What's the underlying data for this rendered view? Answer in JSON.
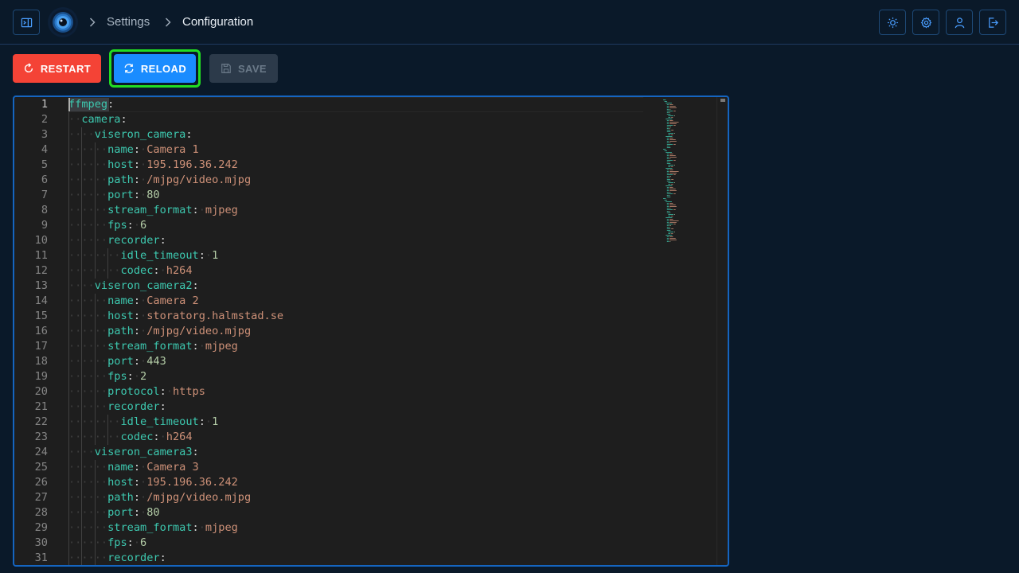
{
  "header": {
    "breadcrumb": [
      "Settings",
      "Configuration"
    ],
    "icons": {
      "menu_toggle": "sidebar-toggle-icon",
      "logo": "viseron-eye-logo",
      "theme": "sun-icon",
      "settings": "gear-icon",
      "profile": "user-icon",
      "logout": "logout-icon"
    }
  },
  "toolbar": {
    "restart_label": "RESTART",
    "reload_label": "RELOAD",
    "save_label": "SAVE"
  },
  "colors": {
    "restart_bg": "#f44336",
    "reload_bg": "#1a8cff",
    "reload_outline": "#22dd22",
    "save_bg": "#2c3a4a",
    "editor_border": "#1565c0",
    "yaml_key": "#3dc9b0",
    "yaml_string": "#ce9178",
    "yaml_number": "#b5cea8"
  },
  "editor": {
    "lines": [
      {
        "n": "1",
        "indent": 0,
        "key": "ffmpeg",
        "value": "",
        "type": ""
      },
      {
        "n": "2",
        "indent": 1,
        "key": "camera",
        "value": "",
        "type": ""
      },
      {
        "n": "3",
        "indent": 2,
        "key": "viseron_camera",
        "value": "",
        "type": ""
      },
      {
        "n": "4",
        "indent": 3,
        "key": "name",
        "value": "Camera 1",
        "type": "s"
      },
      {
        "n": "5",
        "indent": 3,
        "key": "host",
        "value": "195.196.36.242",
        "type": "s"
      },
      {
        "n": "6",
        "indent": 3,
        "key": "path",
        "value": "/mjpg/video.mjpg",
        "type": "s"
      },
      {
        "n": "7",
        "indent": 3,
        "key": "port",
        "value": "80",
        "type": "n"
      },
      {
        "n": "8",
        "indent": 3,
        "key": "stream_format",
        "value": "mjpeg",
        "type": "s"
      },
      {
        "n": "9",
        "indent": 3,
        "key": "fps",
        "value": "6",
        "type": "n"
      },
      {
        "n": "10",
        "indent": 3,
        "key": "recorder",
        "value": "",
        "type": ""
      },
      {
        "n": "11",
        "indent": 4,
        "key": "idle_timeout",
        "value": "1",
        "type": "n"
      },
      {
        "n": "12",
        "indent": 4,
        "key": "codec",
        "value": "h264",
        "type": "s"
      },
      {
        "n": "13",
        "indent": 2,
        "key": "viseron_camera2",
        "value": "",
        "type": ""
      },
      {
        "n": "14",
        "indent": 3,
        "key": "name",
        "value": "Camera 2",
        "type": "s"
      },
      {
        "n": "15",
        "indent": 3,
        "key": "host",
        "value": "storatorg.halmstad.se",
        "type": "s"
      },
      {
        "n": "16",
        "indent": 3,
        "key": "path",
        "value": "/mjpg/video.mjpg",
        "type": "s"
      },
      {
        "n": "17",
        "indent": 3,
        "key": "stream_format",
        "value": "mjpeg",
        "type": "s"
      },
      {
        "n": "18",
        "indent": 3,
        "key": "port",
        "value": "443",
        "type": "n"
      },
      {
        "n": "19",
        "indent": 3,
        "key": "fps",
        "value": "2",
        "type": "n"
      },
      {
        "n": "20",
        "indent": 3,
        "key": "protocol",
        "value": "https",
        "type": "s"
      },
      {
        "n": "21",
        "indent": 3,
        "key": "recorder",
        "value": "",
        "type": ""
      },
      {
        "n": "22",
        "indent": 4,
        "key": "idle_timeout",
        "value": "1",
        "type": "n"
      },
      {
        "n": "23",
        "indent": 4,
        "key": "codec",
        "value": "h264",
        "type": "s"
      },
      {
        "n": "24",
        "indent": 2,
        "key": "viseron_camera3",
        "value": "",
        "type": ""
      },
      {
        "n": "25",
        "indent": 3,
        "key": "name",
        "value": "Camera 3",
        "type": "s"
      },
      {
        "n": "26",
        "indent": 3,
        "key": "host",
        "value": "195.196.36.242",
        "type": "s"
      },
      {
        "n": "27",
        "indent": 3,
        "key": "path",
        "value": "/mjpg/video.mjpg",
        "type": "s"
      },
      {
        "n": "28",
        "indent": 3,
        "key": "port",
        "value": "80",
        "type": "n"
      },
      {
        "n": "29",
        "indent": 3,
        "key": "stream_format",
        "value": "mjpeg",
        "type": "s"
      },
      {
        "n": "30",
        "indent": 3,
        "key": "fps",
        "value": "6",
        "type": "n"
      },
      {
        "n": "31",
        "indent": 3,
        "key": "recorder",
        "value": "",
        "type": ""
      }
    ]
  }
}
